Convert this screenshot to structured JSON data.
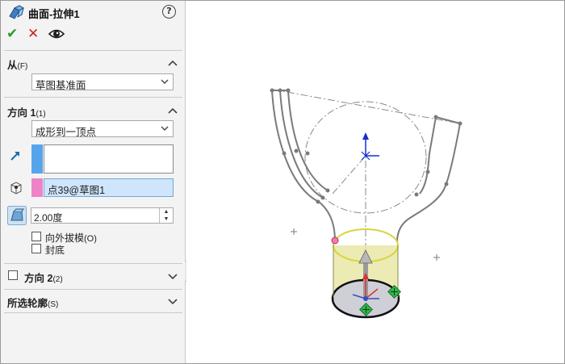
{
  "feature": {
    "title": "曲面-拉伸1",
    "icon": "surface-extrude-icon",
    "help_icon": "question-icon",
    "help_glyph": "?"
  },
  "actions": {
    "ok": "✔",
    "cancel": "✕",
    "ok_icon": "check-icon",
    "cancel_icon": "close-icon",
    "preview_icon": "eye-icon"
  },
  "from": {
    "label": "从",
    "suffix": "(F)",
    "value": "草图基准面"
  },
  "direction1": {
    "label": "方向 1",
    "suffix": "(1)",
    "end_condition": "成形到一顶点",
    "vertex_selection": "点39@草图1",
    "draft_angle": "2.00度",
    "draft_outward_label": "向外拔模",
    "draft_outward_suffix": "(O)",
    "draft_outward_checked": false,
    "cap_end_label": "封底",
    "cap_end_checked": false
  },
  "direction2": {
    "label": "方向 2",
    "suffix": "(2)",
    "checked": false
  },
  "selected_contours": {
    "label": "所选轮廓",
    "suffix": "(S)"
  },
  "colors": {
    "panel_bg": "#f3f3f3",
    "selection_blue": "#56a5ec",
    "selection_pink": "#ee82c6",
    "selected_field": "#cfe5fb",
    "ok_green": "#2a9a2a",
    "cancel_red": "#d02020",
    "preview_fill": "#e9e7a6",
    "preview_edge": "#d6d63a"
  }
}
